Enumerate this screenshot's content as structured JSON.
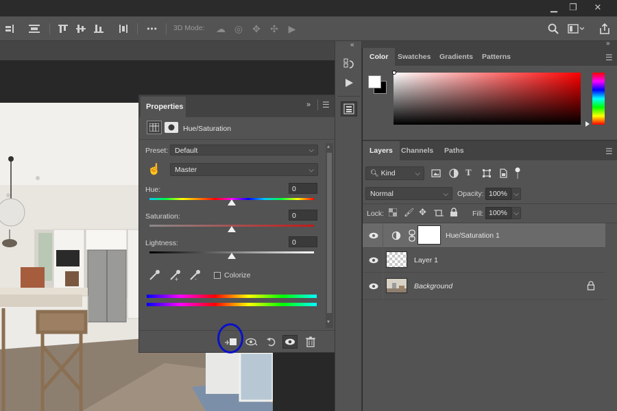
{
  "window": {
    "buttons": {
      "minimize": "▁",
      "restore": "❐",
      "close": "✕"
    }
  },
  "options_bar": {
    "mode_3d_label": "3D Mode:",
    "more_label": "•••"
  },
  "properties": {
    "tab": "Properties",
    "adjustment_title": "Hue/Saturation",
    "preset_label": "Preset:",
    "preset_value": "Default",
    "channel_value": "Master",
    "hue_label": "Hue:",
    "hue_value": "0",
    "saturation_label": "Saturation:",
    "saturation_value": "0",
    "lightness_label": "Lightness:",
    "lightness_value": "0",
    "colorize_label": "Colorize",
    "colorize_checked": false,
    "footer_icons": [
      "clip-to-layer-icon",
      "view-previous-state-icon",
      "reset-icon",
      "visibility-icon",
      "trash-icon"
    ]
  },
  "color_panel": {
    "tabs": [
      "Color",
      "Swatches",
      "Gradients",
      "Patterns"
    ],
    "active_tab": "Color",
    "foreground": "#ffffff",
    "background": "#000000",
    "picker_hue": "#ff0000"
  },
  "layers_panel": {
    "tabs": [
      "Layers",
      "Channels",
      "Paths"
    ],
    "active_tab": "Layers",
    "kind_label": "Kind",
    "blend_mode": "Normal",
    "opacity_label": "Opacity:",
    "opacity_value": "100%",
    "lock_label": "Lock:",
    "fill_label": "Fill:",
    "fill_value": "100%",
    "layers": [
      {
        "name": "Hue/Saturation 1",
        "selected": true,
        "italic": false
      },
      {
        "name": "Layer 1",
        "selected": false,
        "italic": false
      },
      {
        "name": "Background",
        "selected": false,
        "italic": true
      }
    ]
  },
  "colors": {
    "highlight_circle": "#0b10c8",
    "panel_bg": "#535353",
    "selected_row": "#6a6a6a"
  }
}
